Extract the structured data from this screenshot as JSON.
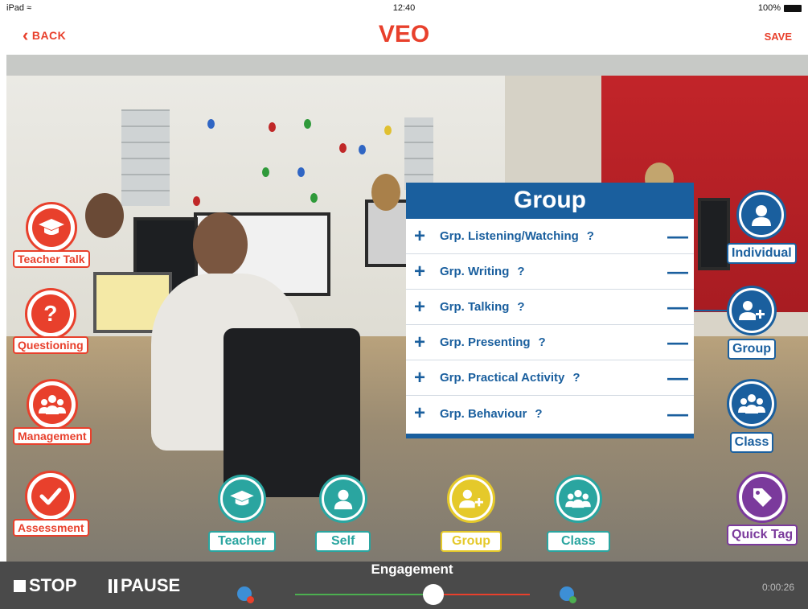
{
  "status_bar": {
    "device": "iPad",
    "time": "12:40",
    "battery": "100%"
  },
  "nav": {
    "back_label": "BACK",
    "title": "VEO",
    "save_label": "SAVE"
  },
  "left_tools": [
    {
      "label": "Teacher Talk"
    },
    {
      "label": "Questioning"
    },
    {
      "label": "Management"
    },
    {
      "label": "Assessment"
    }
  ],
  "group_panel": {
    "title": "Group",
    "rows": [
      {
        "label": "Grp. Listening/Watching",
        "help": "?"
      },
      {
        "label": "Grp. Writing",
        "help": "?"
      },
      {
        "label": "Grp. Talking",
        "help": "?"
      },
      {
        "label": "Grp. Presenting",
        "help": "?"
      },
      {
        "label": "Grp. Practical Activity",
        "help": "?"
      },
      {
        "label": "Grp. Behaviour",
        "help": "?"
      }
    ]
  },
  "right_tools": [
    {
      "label": "Individual"
    },
    {
      "label": "Group"
    },
    {
      "label": "Class"
    },
    {
      "label": "Quick Tag"
    }
  ],
  "bottom_tools": [
    {
      "label": "Teacher"
    },
    {
      "label": "Self"
    },
    {
      "label": "Group"
    },
    {
      "label": "Class"
    }
  ],
  "controls": {
    "stop_label": "STOP",
    "pause_label": "PAUSE",
    "engagement_label": "Engagement",
    "engagement_level": 0.58,
    "timer": "0:00:26"
  },
  "colors": {
    "accent_red": "#e8402c",
    "blue": "#1a5f9e",
    "teal": "#2aa5a0",
    "yellow": "#e5c92a",
    "purple": "#7b3a9c"
  }
}
